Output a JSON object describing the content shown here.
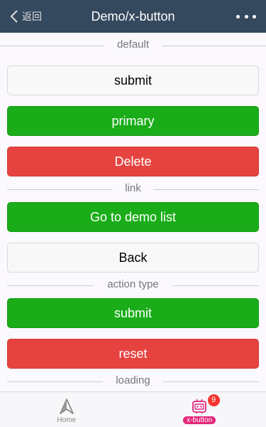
{
  "header": {
    "back_label": "返回",
    "title": "Demo/x-button"
  },
  "sections": [
    {
      "divider": "default",
      "buttons": [
        {
          "label": "submit",
          "type": "default"
        },
        {
          "label": "primary",
          "type": "primary"
        },
        {
          "label": "Delete",
          "type": "warn"
        }
      ]
    },
    {
      "divider": "link",
      "buttons": [
        {
          "label": "Go to demo list",
          "type": "primary"
        },
        {
          "label": "Back",
          "type": "default"
        }
      ]
    },
    {
      "divider": "action type",
      "buttons": [
        {
          "label": "submit",
          "type": "primary"
        },
        {
          "label": "reset",
          "type": "warn"
        }
      ]
    },
    {
      "divider": "loading",
      "buttons": []
    }
  ],
  "tabbar": {
    "home_label": "Home",
    "xbutton_label": "x-button",
    "badge_count": "9"
  },
  "colors": {
    "header_bg": "#35495e",
    "primary": "#1aad19",
    "warn": "#e64340",
    "active_tab_label_bg": "#e2277a"
  }
}
